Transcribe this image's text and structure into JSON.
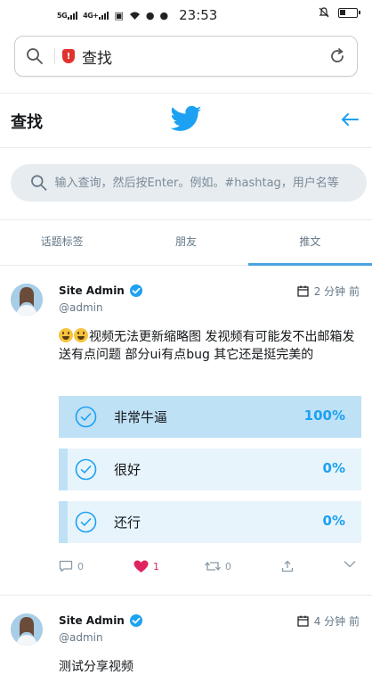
{
  "status_bar": {
    "network_1": "5G",
    "network_2": "4G+",
    "time": "23:53"
  },
  "browser": {
    "query_text": "查找",
    "icons": [
      "search-icon",
      "shield-icon",
      "reload-icon"
    ]
  },
  "header": {
    "title": "查找",
    "logo": "twitter-bird-icon",
    "back": "arrow-left-icon"
  },
  "search": {
    "placeholder": "输入查询，然后按Enter。例如。#hashtag，用户名等"
  },
  "tabs": [
    {
      "label": "话题标签",
      "active": false
    },
    {
      "label": "朋友",
      "active": false
    },
    {
      "label": "推文",
      "active": true
    }
  ],
  "posts": [
    {
      "author": "Site Admin",
      "handle": "@admin",
      "time": "2 分钟 前",
      "text": "视频无法更新缩略图 发视频有可能发不出邮箱发送有点问题 部分ui有点bug 其它还是挺完美的",
      "poll": [
        {
          "label": "非常牛逼",
          "percent": "100%",
          "fraction": 1.0
        },
        {
          "label": "很好",
          "percent": "0%",
          "fraction": 0.0
        },
        {
          "label": "还行",
          "percent": "0%",
          "fraction": 0.0
        }
      ],
      "actions": {
        "replies": "0",
        "likes": "1",
        "retweets": "0"
      }
    },
    {
      "author": "Site Admin",
      "handle": "@admin",
      "time": "4 分钟 前",
      "text": "测试分享视频"
    }
  ],
  "colors": {
    "accent": "#1da1f2",
    "poll_fill": "#bfe1f6",
    "poll_bg": "#e8f4fb",
    "like": "#e0245e"
  }
}
